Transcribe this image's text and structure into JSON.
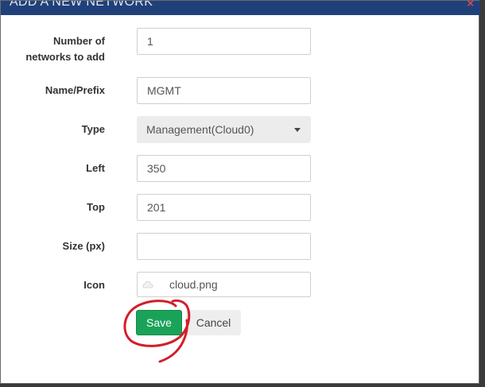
{
  "dialog": {
    "title": "ADD A NEW NETWORK",
    "close_symbol": "×"
  },
  "form": {
    "count": {
      "label_line1": "Number of",
      "label_line2": "networks to add",
      "value": "1"
    },
    "name": {
      "label": "Name/Prefix",
      "value": "MGMT"
    },
    "type": {
      "label": "Type",
      "selected": "Management(Cloud0)"
    },
    "left": {
      "label": "Left",
      "value": "350"
    },
    "top": {
      "label": "Top",
      "value": "201"
    },
    "size": {
      "label": "Size (px)",
      "value": ""
    },
    "icon": {
      "label": "Icon",
      "value": "cloud.png"
    }
  },
  "actions": {
    "save_label": "Save",
    "cancel_label": "Cancel"
  },
  "colors": {
    "header": "#20407a",
    "save_button": "#1aa358",
    "annotation": "#d11f2a",
    "close": "#e0454f"
  },
  "icons": [
    "close-icon",
    "cloud-icon",
    "caret-down-icon"
  ]
}
